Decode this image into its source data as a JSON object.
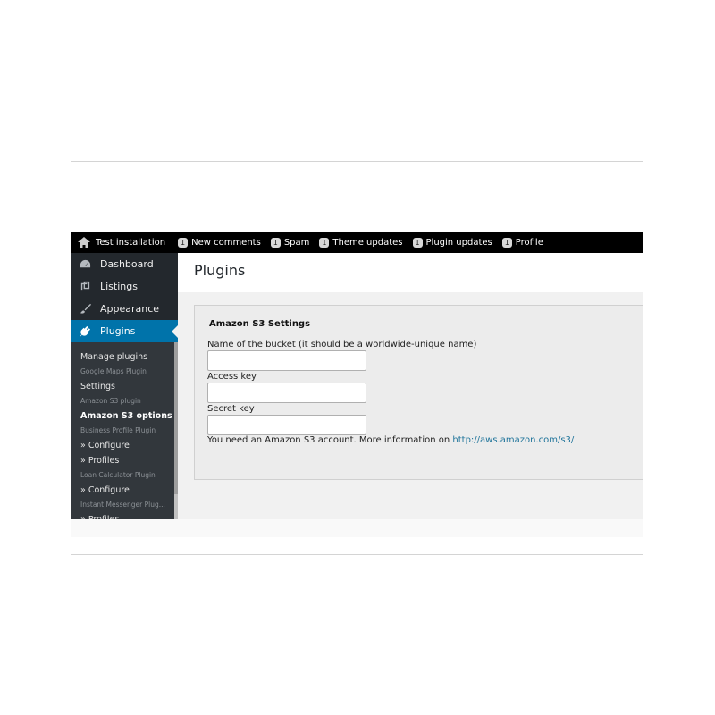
{
  "topbar": {
    "site_name": "Test installation",
    "items": [
      {
        "count": "1",
        "label": "New comments"
      },
      {
        "count": "1",
        "label": "Spam"
      },
      {
        "count": "1",
        "label": "Theme updates"
      },
      {
        "count": "1",
        "label": "Plugin updates"
      },
      {
        "count": "1",
        "label": "Profile"
      }
    ]
  },
  "sidebar": {
    "menu": [
      {
        "label": "Dashboard",
        "icon": "dashboard-icon"
      },
      {
        "label": "Listings",
        "icon": "listings-icon"
      },
      {
        "label": "Appearance",
        "icon": "paintbrush-icon"
      },
      {
        "label": "Plugins",
        "icon": "plugin-icon",
        "active": true
      }
    ],
    "submenu": [
      {
        "label": "Manage plugins",
        "type": "link"
      },
      {
        "label": "Google Maps Plugin",
        "type": "group"
      },
      {
        "label": "Settings",
        "type": "link"
      },
      {
        "label": "Amazon S3 plugin",
        "type": "group"
      },
      {
        "label": "Amazon S3 options",
        "type": "current"
      },
      {
        "label": "Business Profile Plugin",
        "type": "group"
      },
      {
        "label": "» Configure",
        "type": "link"
      },
      {
        "label": "» Profiles",
        "type": "link"
      },
      {
        "label": "Loan Calculator Plugin",
        "type": "group"
      },
      {
        "label": "» Configure",
        "type": "link"
      },
      {
        "label": "Instant Messenger Plug...",
        "type": "group"
      },
      {
        "label": "» Profiles",
        "type": "link"
      }
    ]
  },
  "page": {
    "title": "Plugins"
  },
  "settings": {
    "heading": "Amazon S3 Settings",
    "bucket_label": "Name of the bucket (it should be a worldwide-unique name)",
    "bucket_value": "",
    "access_label": "Access key",
    "access_value": "",
    "secret_label": "Secret key",
    "secret_value": "",
    "info_text": "You need an Amazon S3 account. More information on ",
    "info_link": "http://aws.amazon.com/s3/"
  },
  "colors": {
    "topbar": "#000000",
    "sidebar": "#23282d",
    "active": "#0073aa",
    "link": "#21759b"
  }
}
